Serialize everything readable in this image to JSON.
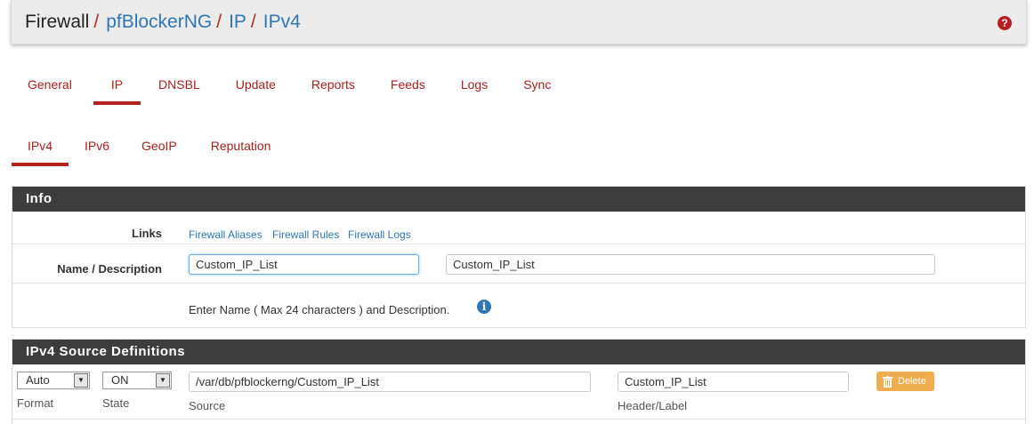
{
  "breadcrumb": {
    "items": [
      "Firewall",
      "pfBlockerNG",
      "IP",
      "IPv4"
    ],
    "separator": "/",
    "help_icon": "question-circle-icon"
  },
  "tabs_main": [
    {
      "label": "General"
    },
    {
      "label": "IP",
      "active": true
    },
    {
      "label": "DNSBL"
    },
    {
      "label": "Update"
    },
    {
      "label": "Reports"
    },
    {
      "label": "Feeds"
    },
    {
      "label": "Logs"
    },
    {
      "label": "Sync"
    }
  ],
  "tabs_sub": [
    {
      "label": "IPv4",
      "active": true
    },
    {
      "label": "IPv6"
    },
    {
      "label": "GeoIP"
    },
    {
      "label": "Reputation"
    }
  ],
  "info_panel": {
    "title": "Info",
    "links_label": "Links",
    "links": [
      "Firewall Aliases",
      "Firewall Rules",
      "Firewall Logs"
    ],
    "name_label": "Name / Description",
    "name_value": "Custom_IP_List",
    "description_value": "Custom_IP_List",
    "help_text": "Enter Name ( Max 24 characters ) and Description.",
    "info_icon": "info-circle-icon"
  },
  "source_panel": {
    "title": "IPv4 Source Definitions",
    "format_value": "Auto",
    "format_label": "Format",
    "state_value": "ON",
    "state_label": "State",
    "source_value": "/var/db/pfblockerng/Custom_IP_List",
    "source_label": "Source",
    "header_value": "Custom_IP_List",
    "header_label": "Header/Label",
    "delete_label": "Delete",
    "delete_icon": "trash-icon"
  },
  "colors": {
    "accent_red": "#b4221c",
    "link_blue": "#2f76b5",
    "panel_header": "#3d3d3d",
    "warning_orange": "#f0ad4e"
  }
}
